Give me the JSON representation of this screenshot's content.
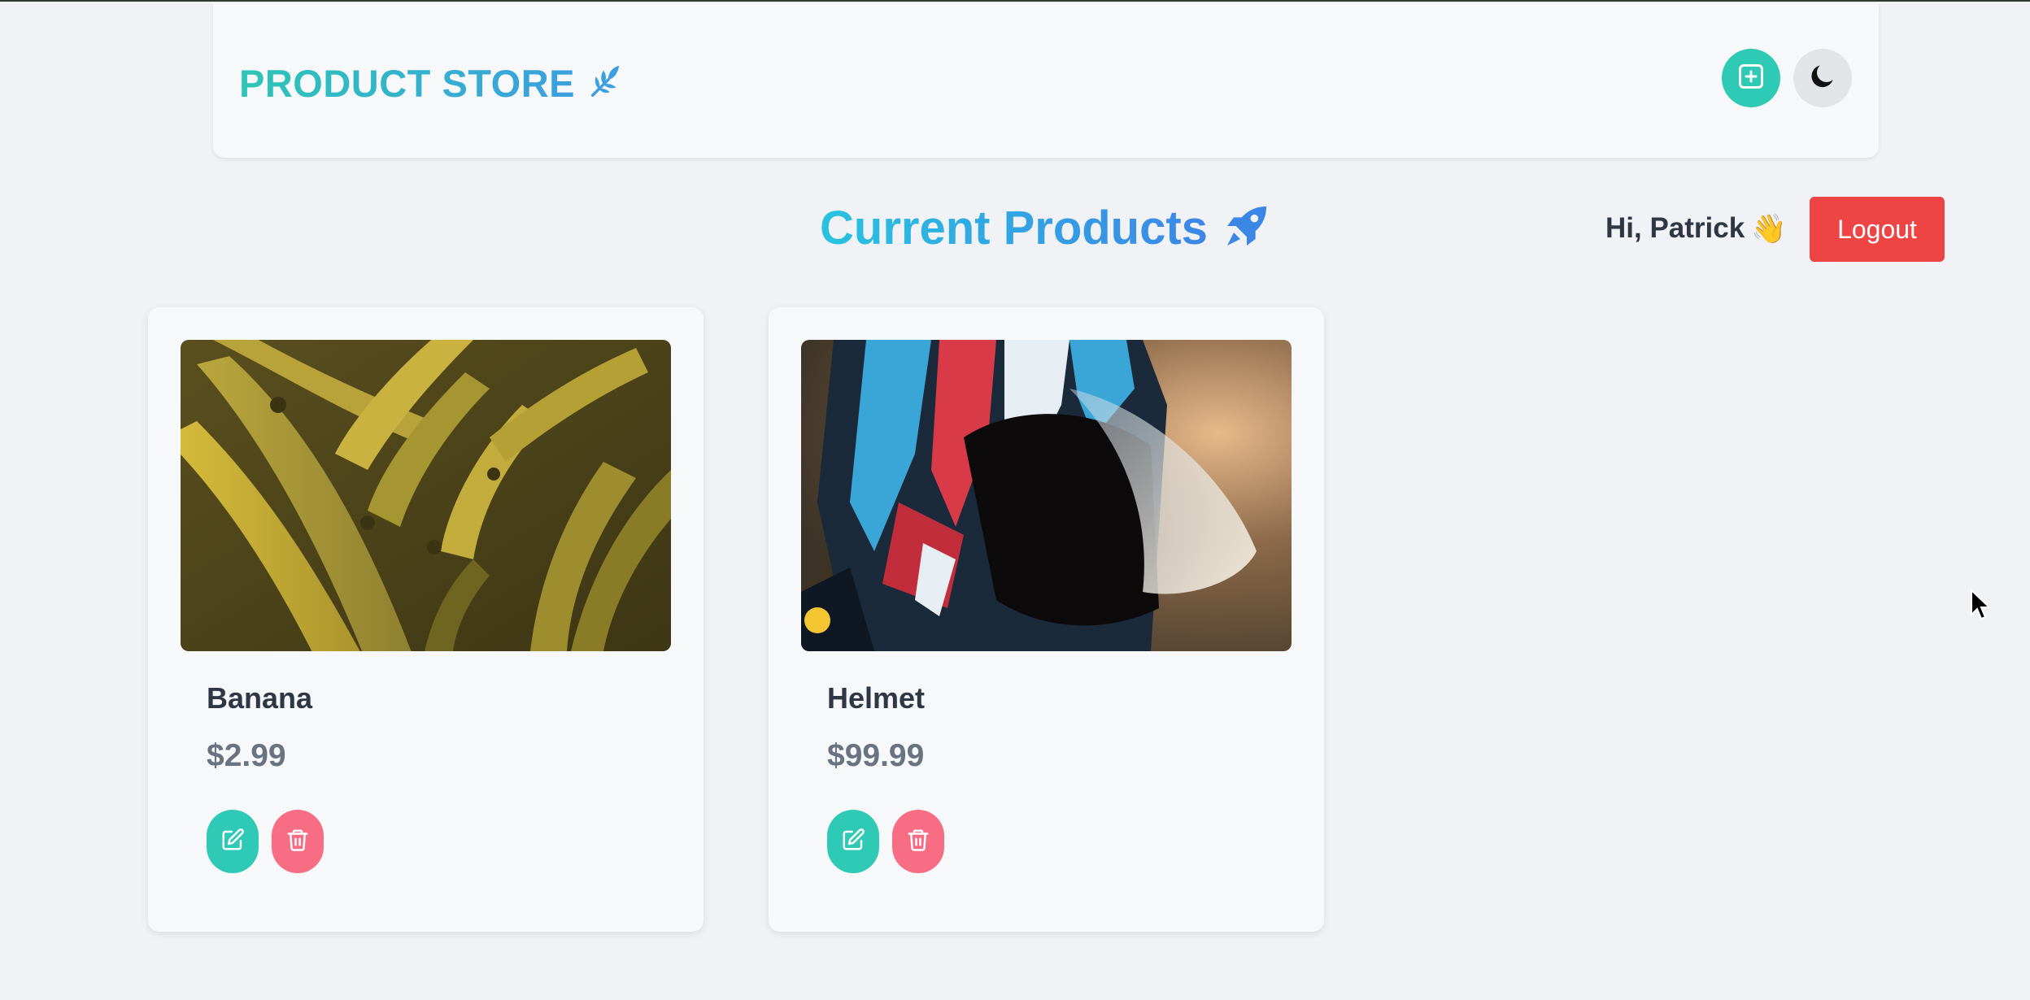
{
  "navbar": {
    "brand_text": "PRODUCT STORE",
    "brand_icon": "leaf-icon",
    "add_button_icon": "plus-square-icon",
    "theme_button_icon": "moon-icon"
  },
  "page": {
    "heading": "Current Products",
    "heading_icon": "rocket-icon"
  },
  "user": {
    "greeting": "Hi, Patrick",
    "greeting_emoji": "👋",
    "logout_label": "Logout"
  },
  "products": [
    {
      "name": "Banana",
      "price": "$2.99",
      "image": "photo of a pile of bananas"
    },
    {
      "name": "Helmet",
      "price": "$99.99",
      "image": "photo of a motocross helmet with visor"
    }
  ],
  "colors": {
    "brand_start": "#2ec5b6",
    "brand_end": "#3b9fe0",
    "teal_button": "#2fcab5",
    "delete_button": "#f76e84",
    "logout_button": "#ee4444",
    "background": "#f0f2f5",
    "card_background": "#f7f8fa"
  }
}
